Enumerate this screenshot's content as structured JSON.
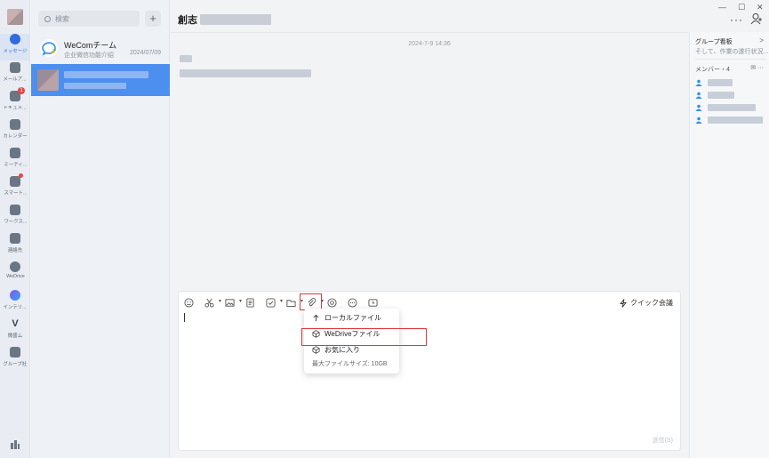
{
  "rail": {
    "items": [
      {
        "label": "メッセージ",
        "icon": "chat-bubble-icon",
        "active": true
      },
      {
        "label": "メールア...",
        "icon": "mail-icon"
      },
      {
        "label": "ドキュメ...",
        "icon": "document-icon",
        "badge": "1"
      },
      {
        "label": "カレンダー",
        "icon": "calendar-icon"
      },
      {
        "label": "ミーティ...",
        "icon": "meeting-icon"
      },
      {
        "label": "スマート...",
        "icon": "smart-icon",
        "dot": true
      },
      {
        "label": "ワークス...",
        "icon": "workspace-grid-icon"
      },
      {
        "label": "連絡先",
        "icon": "contacts-icon"
      },
      {
        "label": "WeDrive",
        "icon": "wedrive-icon"
      },
      {
        "label": "インテリ...",
        "icon": "intelligence-icon"
      },
      {
        "label": "微盛ム",
        "icon": "v-logo-icon"
      },
      {
        "label": "グループ社",
        "icon": "group-icon"
      }
    ]
  },
  "list": {
    "search_placeholder": "検索",
    "add_label": "+",
    "conversations": [
      {
        "name": "WeComチーム",
        "sub": "企业微信功能介绍",
        "date": "2024/07/09"
      }
    ]
  },
  "chat": {
    "title_prefix": "創志",
    "timestamp": "2024-7-9 14:36",
    "toolbar": {
      "quick_meeting": "クイック会議"
    },
    "send_label": "送信(S)"
  },
  "dropdown": {
    "items": [
      {
        "label": "ローカルファイル",
        "icon": "upload-arrow-icon"
      },
      {
        "label": "WeDriveファイル",
        "icon": "wedrive-cube-icon"
      },
      {
        "label": "お気に入り",
        "icon": "favorite-cube-icon"
      }
    ],
    "note": "最大ファイルサイズ: 10GB"
  },
  "right_panel": {
    "title": "グループ看板",
    "arrow": ">",
    "subtitle": "そして、作業の遂行状況...",
    "members_label": "メンバー・4",
    "member_count": 4
  },
  "window": {
    "minimize": "—",
    "maximize": "☐",
    "close": "✕",
    "more": "···"
  },
  "colors": {
    "accent": "#2f6bdf",
    "selected_row": "#4c8fee",
    "highlight": "#e0373c",
    "badge": "#e64545"
  }
}
